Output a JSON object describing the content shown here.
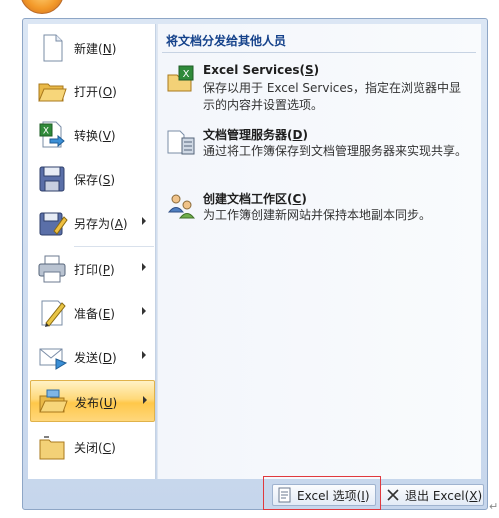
{
  "menu": {
    "items": [
      {
        "label": "新建",
        "key": "N"
      },
      {
        "label": "打开",
        "key": "O"
      },
      {
        "label": "转换",
        "key": "V"
      },
      {
        "label": "保存",
        "key": "S"
      },
      {
        "label": "另存为",
        "key": "A"
      },
      {
        "label": "打印",
        "key": "P"
      },
      {
        "label": "准备",
        "key": "E"
      },
      {
        "label": "发送",
        "key": "D"
      },
      {
        "label": "发布",
        "key": "U"
      },
      {
        "label": "关闭",
        "key": "C"
      }
    ]
  },
  "panel": {
    "title": "将文档分发给其他人员",
    "items": [
      {
        "title": "Excel Services",
        "key": "S",
        "desc": "保存以用于 Excel Services，指定在浏览器中显示的内容并设置选项。"
      },
      {
        "title": "文档管理服务器",
        "key": "D",
        "desc": "通过将工作簿保存到文档管理服务器来实现共享。"
      },
      {
        "title": "创建文档工作区",
        "key": "C",
        "desc": "为工作簿创建新网站并保持本地副本同步。"
      }
    ]
  },
  "footer": {
    "options_label": "Excel 选项",
    "options_key": "I",
    "exit_label": "退出 Excel",
    "exit_key": "X"
  },
  "colors": {
    "active_item": "#ffd97a",
    "panel_title": "#15428b",
    "frame": "#c6d6ec",
    "highlight_box": "#e0393e"
  }
}
